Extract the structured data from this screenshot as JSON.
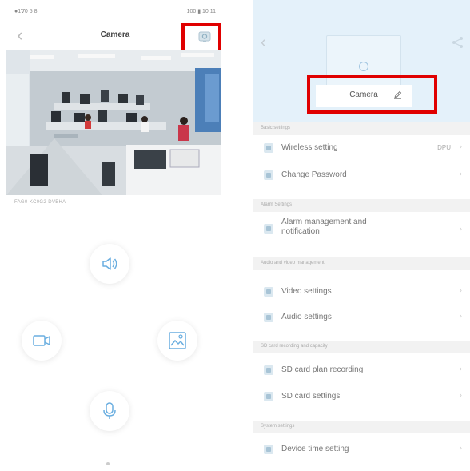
{
  "left": {
    "status_left": "●1ᐁ0 5 8",
    "status_right": "100 ▮ 10:11",
    "back_icon": "chevron-left-icon",
    "title": "Camera",
    "settings_icon": "gear-icon",
    "device_id": "FAG0-KC0G2-DVBHA",
    "controls": [
      {
        "name": "speaker-icon"
      },
      {
        "name": "record-icon"
      },
      {
        "name": "album-icon"
      },
      {
        "name": "microphone-icon"
      }
    ]
  },
  "right": {
    "back_icon": "chevron-left-icon",
    "share_icon": "share-icon",
    "camera_name": "Camera",
    "edit_icon": "pencil-icon",
    "sections": [
      {
        "title": "Basic settings",
        "items": [
          {
            "label": "Wireless setting",
            "value": "DPU"
          },
          {
            "label": "Change Password",
            "value": ""
          }
        ]
      },
      {
        "title": "Alarm Settings",
        "items": [
          {
            "label": "Alarm management and notification",
            "value": ""
          }
        ]
      },
      {
        "title": "Audio and video management",
        "items": [
          {
            "label": "Video settings",
            "value": ""
          },
          {
            "label": "Audio settings",
            "value": ""
          }
        ]
      },
      {
        "title": "SD card recording and capacity",
        "items": [
          {
            "label": "SD card plan recording",
            "value": ""
          },
          {
            "label": "SD card settings",
            "value": ""
          }
        ]
      },
      {
        "title": "System settings",
        "items": [
          {
            "label": "Device time setting",
            "value": ""
          }
        ]
      }
    ]
  },
  "colors": {
    "highlight": "#e00000",
    "accent": "#5aa6dc",
    "header_bg": "#e4f1fa"
  }
}
